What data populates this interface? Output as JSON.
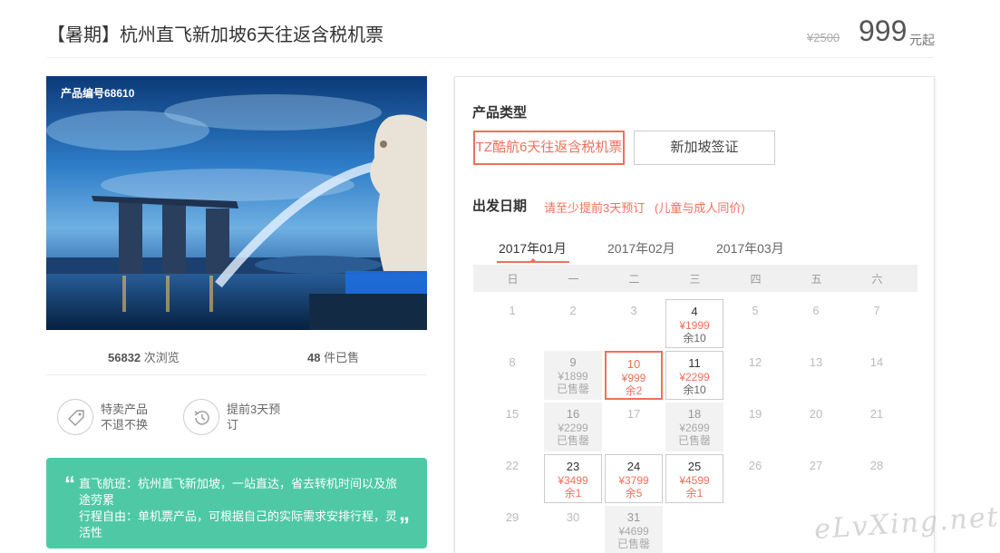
{
  "header": {
    "title": "【暑期】杭州直飞新加坡6天往返含税机票",
    "price_old": "¥2500",
    "price_now": "999",
    "price_suffix": "元起"
  },
  "product": {
    "code": "产品编号68610",
    "views_num": "56832",
    "views_label": "次浏览",
    "sold_num": "48",
    "sold_label": "件已售"
  },
  "features": [
    {
      "icon": "tag-icon",
      "text": "特卖产品不退不换"
    },
    {
      "icon": "clock-history-icon",
      "text": "提前3天预订"
    }
  ],
  "quote": {
    "open": "“",
    "close": "”",
    "line1": "直飞航班：杭州直飞新加坡，一站直达，省去转机时间以及旅途劳累",
    "line2": "行程自由：单机票产品，可根据自己的实际需求安排行程，灵活性"
  },
  "booking": {
    "type_label": "产品类型",
    "options": [
      "TZ酷航6天往返含税机票",
      "新加坡签证"
    ],
    "date_label": "出发日期",
    "date_tip": "请至少提前3天预订",
    "date_note": "(儿童与成人同价)",
    "months": [
      "2017年01月",
      "2017年02月",
      "2017年03月"
    ],
    "weekdays": [
      "日",
      "一",
      "二",
      "三",
      "四",
      "五",
      "六"
    ]
  },
  "calendar": [
    {
      "day": "1"
    },
    {
      "day": "2"
    },
    {
      "day": "3"
    },
    {
      "day": "4",
      "price": "¥1999",
      "status": "余10",
      "state": "avail"
    },
    {
      "day": "5"
    },
    {
      "day": "6"
    },
    {
      "day": "7"
    },
    {
      "day": "8"
    },
    {
      "day": "9",
      "price": "¥1899",
      "status": "已售罄",
      "state": "soldout"
    },
    {
      "day": "10",
      "price": "¥999",
      "status": "余2",
      "state": "selected"
    },
    {
      "day": "11",
      "price": "¥2299",
      "status": "余10",
      "state": "avail"
    },
    {
      "day": "12"
    },
    {
      "day": "13"
    },
    {
      "day": "14"
    },
    {
      "day": "15"
    },
    {
      "day": "16",
      "price": "¥2299",
      "status": "已售罄",
      "state": "soldout"
    },
    {
      "day": "17"
    },
    {
      "day": "18",
      "price": "¥2699",
      "status": "已售罄",
      "state": "soldout"
    },
    {
      "day": "19"
    },
    {
      "day": "20"
    },
    {
      "day": "21"
    },
    {
      "day": "22"
    },
    {
      "day": "23",
      "price": "¥3499",
      "status": "余1",
      "state": "red"
    },
    {
      "day": "24",
      "price": "¥3799",
      "status": "余5",
      "state": "red"
    },
    {
      "day": "25",
      "price": "¥4599",
      "status": "余1",
      "state": "red"
    },
    {
      "day": "26"
    },
    {
      "day": "27"
    },
    {
      "day": "28"
    },
    {
      "day": "29"
    },
    {
      "day": "30"
    },
    {
      "day": "31",
      "price": "¥4699",
      "status": "已售罄",
      "state": "soldout"
    }
  ],
  "watermark": "eLvXing.net"
}
